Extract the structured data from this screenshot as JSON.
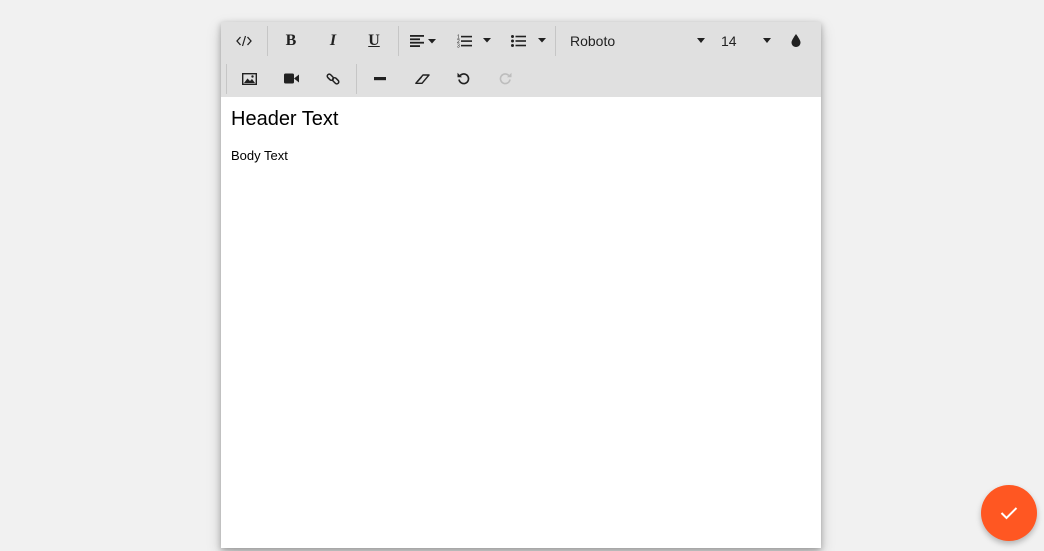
{
  "toolbar": {
    "font_family": "Roboto",
    "font_size": "14",
    "bold_label": "B",
    "italic_label": "I",
    "underline_label": "U"
  },
  "content": {
    "header": "Header Text",
    "body": "Body Text"
  },
  "colors": {
    "toolbar_bg": "#e0e0e0",
    "fab": "#ff5722",
    "disabled_icon": "#bdbdbd"
  },
  "icons": [
    "code-view-icon",
    "bold-icon",
    "italic-icon",
    "underline-icon",
    "align-left-icon",
    "ordered-list-icon",
    "unordered-list-icon",
    "font-color-icon",
    "image-icon",
    "video-icon",
    "link-icon",
    "horizontal-rule-icon",
    "clear-format-icon",
    "undo-icon",
    "redo-icon",
    "check-icon"
  ]
}
